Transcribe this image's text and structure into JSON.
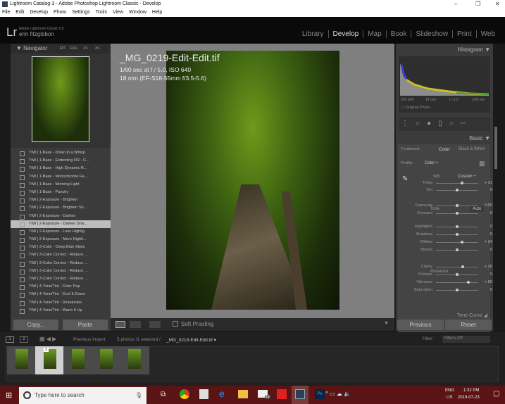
{
  "window": {
    "title": "Lightroom Catalog-3 - Adobe Photoshop Lightroom Classic - Develop",
    "controls": [
      "–",
      "❐",
      "✕"
    ]
  },
  "menu": [
    "File",
    "Edit",
    "Develop",
    "Photo",
    "Settings",
    "Tools",
    "View",
    "Window",
    "Help"
  ],
  "identity": {
    "logo": "Lr",
    "product": "Adobe Lightroom Classic CC",
    "user": "erin fitzgibbon"
  },
  "modules": [
    "Library",
    "Develop",
    "Map",
    "Book",
    "Slideshow",
    "Print",
    "Web"
  ],
  "navigator": {
    "title": "Navigator",
    "zoom": [
      "FIT",
      "FILL",
      "1:1",
      "3:1"
    ]
  },
  "presets": [
    "TtW | 1-Base - Down to a Whisp",
    "TtW | 1-Base - Exdenting DR - C...",
    "TtW | 1-Base - High Dynamic R...",
    "TtW | 1-Base - Monochrome Fa...",
    "TtW | 1-Base - Morning Light",
    "TtW | 1-Base - Punchy",
    "TtW | 2-Exposure - Brighten",
    "TtW | 2-Exposure - Brighten Sh...",
    "TtW | 2-Exposure - Darken",
    "TtW | 2-Exposure - Darken Sha...",
    "TtW | 2-Exposure - Less Highlig",
    "TtW | 2-Exposure - More Highli...",
    "TtW | 3-Color - Deep Blue Skies",
    "TtW | 3-Color Correct - Reduce ...",
    "TtW | 3-Color Correct - Reduce ...",
    "TtW | 3-Color Correct - Reduce ...",
    "TtW | 3-Color Correct - Reduce ...",
    "TtW | 4-Tone/Tint - Color Pop",
    "TtW | 4-Tone/Tint - Cool It Down",
    "TtW | 4-Tone/Tint - Desaturate",
    "TtW | 4-Tone/Tint - Warm It Up"
  ],
  "left_buttons": {
    "copy": "Copy...",
    "paste": "Paste"
  },
  "photo_info": {
    "filename": "_MG_0219-Edit-Edit.tif",
    "exposure": "1/60 sec at f / 5.0, ISO 640",
    "lens": "18 mm (EF-S18-55mm f/3.5-5.6)"
  },
  "toolbar": {
    "soft_proofing": "Soft Proofing"
  },
  "histogram": {
    "title": "Histogram",
    "iso": "ISO 640",
    "focal": "18 mm",
    "aperture": "f / 5.0",
    "shutter": "1/60 sec",
    "original": "Original Photo"
  },
  "basic": {
    "title": "Basic",
    "treatment_label": "Treatment :",
    "color": "Color",
    "bw": "Black & White",
    "profile_label": "Profile :",
    "profile": "Color ÷",
    "wb_label": "WB :",
    "wb": "Custom ÷",
    "tone": "Tone",
    "auto": "Auto",
    "presence": "Presence",
    "sliders": [
      {
        "label": "Temp",
        "value": "+ 31",
        "pos": 0.62
      },
      {
        "label": "Tint",
        "value": "0",
        "pos": 0.5
      },
      {
        "label": "Exposure",
        "value": "0.00",
        "pos": 0.5
      },
      {
        "label": "Contrast",
        "value": "0",
        "pos": 0.5
      },
      {
        "label": "Highlights",
        "value": "0",
        "pos": 0.5
      },
      {
        "label": "Shadows",
        "value": "0",
        "pos": 0.5
      },
      {
        "label": "Whites",
        "value": "+ 24",
        "pos": 0.62
      },
      {
        "label": "Blacks",
        "value": "0",
        "pos": 0.5
      },
      {
        "label": "Clarity",
        "value": "+ 26",
        "pos": 0.63
      },
      {
        "label": "Dehaze",
        "value": "0",
        "pos": 0.5
      },
      {
        "label": "Vibrance",
        "value": "+ 55",
        "pos": 0.77
      },
      {
        "label": "Saturation",
        "value": "0",
        "pos": 0.5
      }
    ]
  },
  "tone_curve": "Tone Curve",
  "right_buttons": {
    "previous": "Previous",
    "reset": "Reset"
  },
  "filmstrip": {
    "source": "Previous Import",
    "info": "5 photos /1 selected /",
    "file": "_MG_0219-Edit-Edit.tif",
    "filter_label": "Filter :",
    "filter": "Filters Off",
    "selected_badge": "3"
  },
  "taskbar": {
    "search_placeholder": "Type here to search",
    "lang": "ENG",
    "region": "US",
    "time": "1:32 PM",
    "date": "2019-07-23",
    "mail_badge": "16"
  }
}
